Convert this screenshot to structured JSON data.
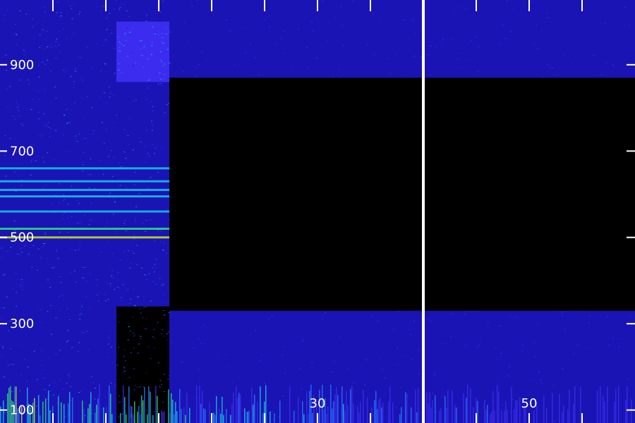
{
  "chart_data": {
    "type": "heatmap",
    "title": "",
    "xlabel": "",
    "ylabel": "",
    "xlim": [
      0,
      60
    ],
    "ylim": [
      70,
      1050
    ],
    "grid": false,
    "background_color": "#000000",
    "colormap": [
      "#000000",
      "#1a14b4",
      "#3c2cf0",
      "#2878ff",
      "#18c8e6",
      "#30e07a",
      "#c8e81c",
      "#ff7a10"
    ],
    "y_ticks": [
      {
        "value": 100,
        "label": "100"
      },
      {
        "value": 300,
        "label": "300"
      },
      {
        "value": 500,
        "label": "500"
      },
      {
        "value": 700,
        "label": "700"
      },
      {
        "value": 900,
        "label": "900"
      }
    ],
    "x_ticks": [
      {
        "value": 30,
        "label": "30"
      },
      {
        "value": 50,
        "label": "50"
      }
    ],
    "x_minor_ticks": [
      5,
      10,
      15,
      20,
      25,
      35,
      40,
      45,
      55
    ],
    "cursor_marker_x": 40,
    "regions": [
      {
        "x": [
          0,
          16
        ],
        "y": [
          70,
          1050
        ],
        "level": 0.3,
        "note": "broadband noise, pre-attenuation"
      },
      {
        "x": [
          11,
          16
        ],
        "y": [
          70,
          340
        ],
        "level": 0.05,
        "note": "dimmed block"
      },
      {
        "x": [
          11,
          16
        ],
        "y": [
          860,
          1000
        ],
        "level": 0.45,
        "note": "bright patch"
      },
      {
        "x": [
          16,
          60
        ],
        "y": [
          330,
          870
        ],
        "level": 0.0,
        "note": "blanked band"
      },
      {
        "x": [
          16,
          60
        ],
        "y": [
          870,
          1050
        ],
        "level": 0.18,
        "note": "faint upper noise"
      },
      {
        "x": [
          16,
          60
        ],
        "y": [
          70,
          330
        ],
        "level": 0.18,
        "note": "faint lower noise"
      }
    ],
    "horizontal_lines": [
      {
        "y": 660,
        "x": [
          0,
          16
        ],
        "level": 0.55
      },
      {
        "y": 630,
        "x": [
          0,
          16
        ],
        "level": 0.5
      },
      {
        "y": 610,
        "x": [
          0,
          16
        ],
        "level": 0.55
      },
      {
        "y": 595,
        "x": [
          0,
          16
        ],
        "level": 0.6
      },
      {
        "y": 560,
        "x": [
          0,
          16
        ],
        "level": 0.6
      },
      {
        "y": 520,
        "x": [
          0,
          16
        ],
        "level": 0.7
      },
      {
        "y": 500,
        "x": [
          0,
          16
        ],
        "level": 0.85
      }
    ],
    "bursts": [
      {
        "x": [
          0,
          60
        ],
        "y": [
          70,
          160
        ],
        "level": 0.55,
        "note": "transient low-frequency activity"
      }
    ]
  }
}
